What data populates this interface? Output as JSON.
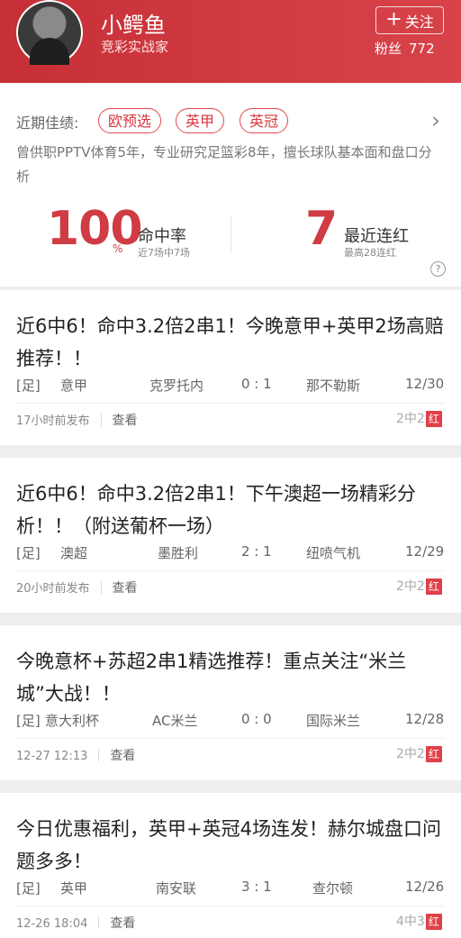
{
  "header": {
    "name": "小鳄鱼",
    "subtitle": "竞彩实战家",
    "follow_label": "关注",
    "follow_icon": "plus-icon",
    "fans_label": "粉丝",
    "fans_count": "772"
  },
  "profile": {
    "recent_label": "近期佳绩:",
    "tags": [
      "欧预选",
      "英甲",
      "英冠"
    ],
    "bio": "曾供职PPTV体育5年，专业研究足篮彩8年，擅长球队基本面和盘口分析",
    "hit_rate": "100",
    "hit_rate_unit": "%",
    "hit_rate_title": "命中率",
    "hit_rate_sub": "近7场中7场",
    "streak": "7",
    "streak_title": "最近连红",
    "streak_sub": "最高28连红",
    "help_icon": "?"
  },
  "articles": [
    {
      "title": "近6中6！命中3.2倍2串1！今晚意甲+英甲2场高赔推荐！！",
      "sport": "[足]",
      "league": "意甲",
      "home": "克罗托内",
      "score": "0 : 1",
      "away": "那不勒斯",
      "date": "12/30",
      "published": "17小时前发布",
      "view_label": "查看",
      "result_prefix": "2中2",
      "result_badge": "红"
    },
    {
      "title": "近6中6！命中3.2倍2串1！下午澳超一场精彩分析！！（附送葡杯一场）",
      "sport": "[足]",
      "league": "澳超",
      "home": "墨胜利",
      "score": "2 : 1",
      "away": "纽喷气机",
      "date": "12/29",
      "published": "20小时前发布",
      "view_label": "查看",
      "result_prefix": "2中2",
      "result_badge": "红"
    },
    {
      "title": "今晚意杯+苏超2串1精选推荐！重点关注“米兰城”大战！！",
      "sport": "[足]",
      "league": "意大利杯",
      "home": "AC米兰",
      "score": "0 : 0",
      "away": "国际米兰",
      "date": "12/28",
      "published": "12-27 12:13",
      "view_label": "查看",
      "result_prefix": "2中2",
      "result_badge": "红"
    },
    {
      "title": "今日优惠福利，英甲+英冠4场连发！赫尔城盘口问题多多！",
      "sport": "[足]",
      "league": "英甲",
      "home": "南安联",
      "score": "3 : 1",
      "away": "查尔顿",
      "date": "12/26",
      "published": "12-26 18:04",
      "view_label": "查看",
      "result_prefix": "4中3",
      "result_badge": "红"
    }
  ],
  "colors": {
    "brand_red": "#d9363e",
    "badge_red": "#e04048"
  }
}
